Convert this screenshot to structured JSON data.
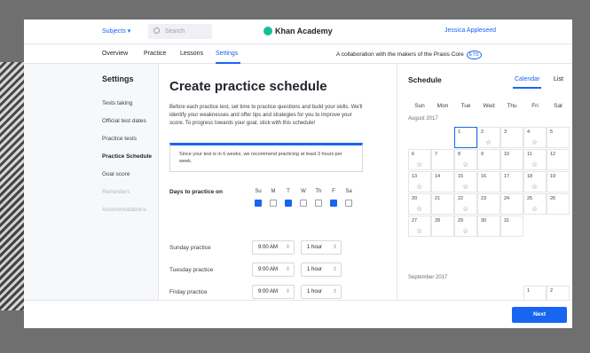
{
  "header": {
    "subjects_label": "Subjects ▾",
    "search_placeholder": "Search",
    "logo": "Khan Academy",
    "user": "Jessica Appleseed"
  },
  "subnav": {
    "tabs": [
      "Overview",
      "Practice",
      "Lessons",
      "Settings"
    ],
    "active_tab": "Settings",
    "collab": "A collaboration with the makers of the Praxis Core",
    "ets": "ETS"
  },
  "sidebar": {
    "title": "Settings",
    "items": [
      "Tests taking",
      "Official test dates",
      "Practice tests",
      "Practice Schedule",
      "Goal score",
      "Reminders",
      "Accommodations"
    ]
  },
  "main": {
    "title": "Create practice schedule",
    "description": "Before each practice test, set time to practice questions and build your skills. We'll identify your weaknesses and offer tips and strategies for you to improve your score. To progress towards your goal, stick with this schedule!",
    "recommendation": "Since your test is in 6 weeks, we recommend practicing at least 3 hours per week.",
    "days_label": "Days to practice on",
    "days": [
      "Su",
      "M",
      "T",
      "W",
      "Th",
      "F",
      "Sa"
    ],
    "days_checked": [
      true,
      false,
      true,
      false,
      false,
      true,
      false
    ],
    "rows": [
      {
        "label": "Sunday practice",
        "time": "9:00 AM",
        "duration": "1 hour"
      },
      {
        "label": "Tuesday practice",
        "time": "9:00 AM",
        "duration": "1 hour"
      },
      {
        "label": "Friday practice",
        "time": "9:00 AM",
        "duration": "1 hour"
      }
    ]
  },
  "schedule": {
    "title": "Schedule",
    "views": [
      "Calendar",
      "List"
    ],
    "active_view": "Calendar",
    "weekdays": [
      "Sun",
      "Mon",
      "Tue",
      "Wed",
      "Thu",
      "Fri",
      "Sat"
    ],
    "month1": "August 2017",
    "month2": "September 2017"
  },
  "footer": {
    "next_label": "Next"
  },
  "colors": {
    "accent": "#1865f2",
    "logo_green": "#14bf96"
  }
}
